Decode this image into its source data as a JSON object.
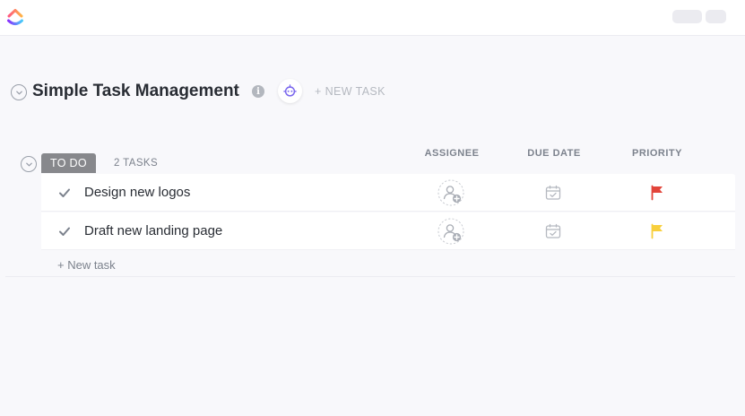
{
  "topbar": {
    "logo_icon": "clickup-logo",
    "buttons": [
      "",
      ""
    ]
  },
  "list": {
    "title": "Simple Task Management",
    "info_icon_glyph": "i",
    "new_task_label": "+ NEW TASK"
  },
  "group": {
    "status": "TO DO",
    "task_count": "2 TASKS",
    "columns": {
      "assignee": "ASSIGNEE",
      "due_date": "DUE DATE",
      "priority": "PRIORITY"
    }
  },
  "tasks": [
    {
      "name": "Design new logos",
      "priority_color": "#e2443a"
    },
    {
      "name": "Draft new landing page",
      "priority_color": "#f8cf3c"
    }
  ],
  "add_task_label": "+ New task",
  "colors": {
    "accent": "#7b68ee",
    "status_gray": "#87888c",
    "priority_urgent": "#e2443a",
    "priority_normal": "#f8cf3c"
  }
}
